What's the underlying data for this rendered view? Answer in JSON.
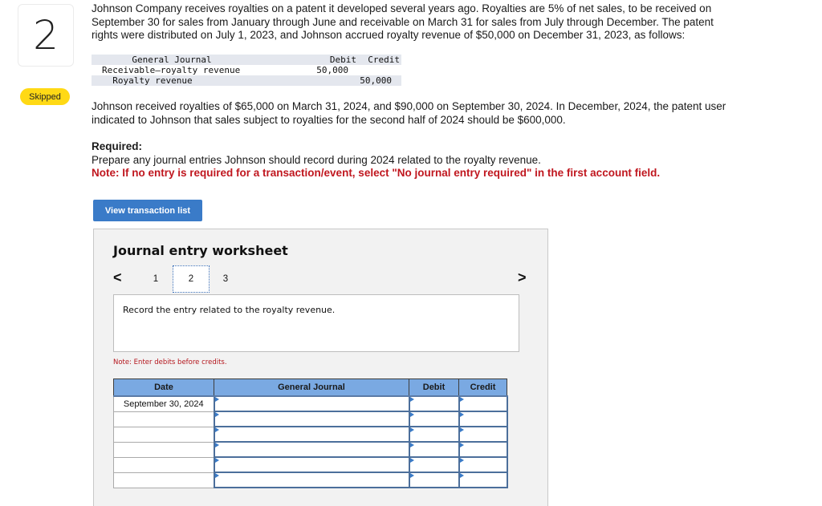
{
  "question": {
    "number": "2",
    "status_badge": "Skipped"
  },
  "problem": {
    "paragraph1": "Johnson Company receives royalties on a patent it developed several years ago. Royalties are 5% of net sales, to be received on September 30 for sales from January through June and receivable on March 31 for sales from July through December. The patent rights were distributed on July 1, 2023, and Johnson accrued royalty revenue of $50,000 on December 31, 2023, as follows:",
    "journal_example": {
      "headers": {
        "account": "General Journal",
        "debit": "Debit",
        "credit": "Credit"
      },
      "rows": [
        {
          "account": "Receivable—royalty revenue",
          "debit": "50,000",
          "credit": ""
        },
        {
          "account": "  Royalty revenue",
          "debit": "",
          "credit": "50,000"
        }
      ]
    },
    "paragraph2": "Johnson received royalties of $65,000 on March 31, 2024, and $90,000 on September 30, 2024. In December, 2024, the patent user indicated to Johnson that sales subject to royalties for the second half of 2024 should be $600,000.",
    "required_label": "Required:",
    "required_text": "Prepare any journal entries Johnson should record during 2024 related to the royalty revenue.",
    "note": "Note: If no entry is required for a transaction/event, select \"No journal entry required\" in the first account field."
  },
  "buttons": {
    "view_transaction_list": "View transaction list"
  },
  "worksheet": {
    "title": "Journal entry worksheet",
    "nav": {
      "prev_icon": "<",
      "next_icon": ">"
    },
    "pages": [
      "1",
      "2",
      "3"
    ],
    "active_page": "2",
    "instruction": "Record the entry related to the royalty revenue.",
    "note": "Note: Enter debits before credits.",
    "table": {
      "headers": {
        "date": "Date",
        "account": "General Journal",
        "debit": "Debit",
        "credit": "Credit"
      },
      "rows": [
        {
          "date": "September 30, 2024",
          "account": "",
          "debit": "",
          "credit": ""
        },
        {
          "date": "",
          "account": "",
          "debit": "",
          "credit": ""
        },
        {
          "date": "",
          "account": "",
          "debit": "",
          "credit": ""
        },
        {
          "date": "",
          "account": "",
          "debit": "",
          "credit": ""
        },
        {
          "date": "",
          "account": "",
          "debit": "",
          "credit": ""
        },
        {
          "date": "",
          "account": "",
          "debit": "",
          "credit": ""
        }
      ]
    }
  },
  "colors": {
    "badge": "#ffd915",
    "primary_button": "#3a7bc8",
    "table_header": "#7aa9e2",
    "note_red": "#c0171f"
  }
}
